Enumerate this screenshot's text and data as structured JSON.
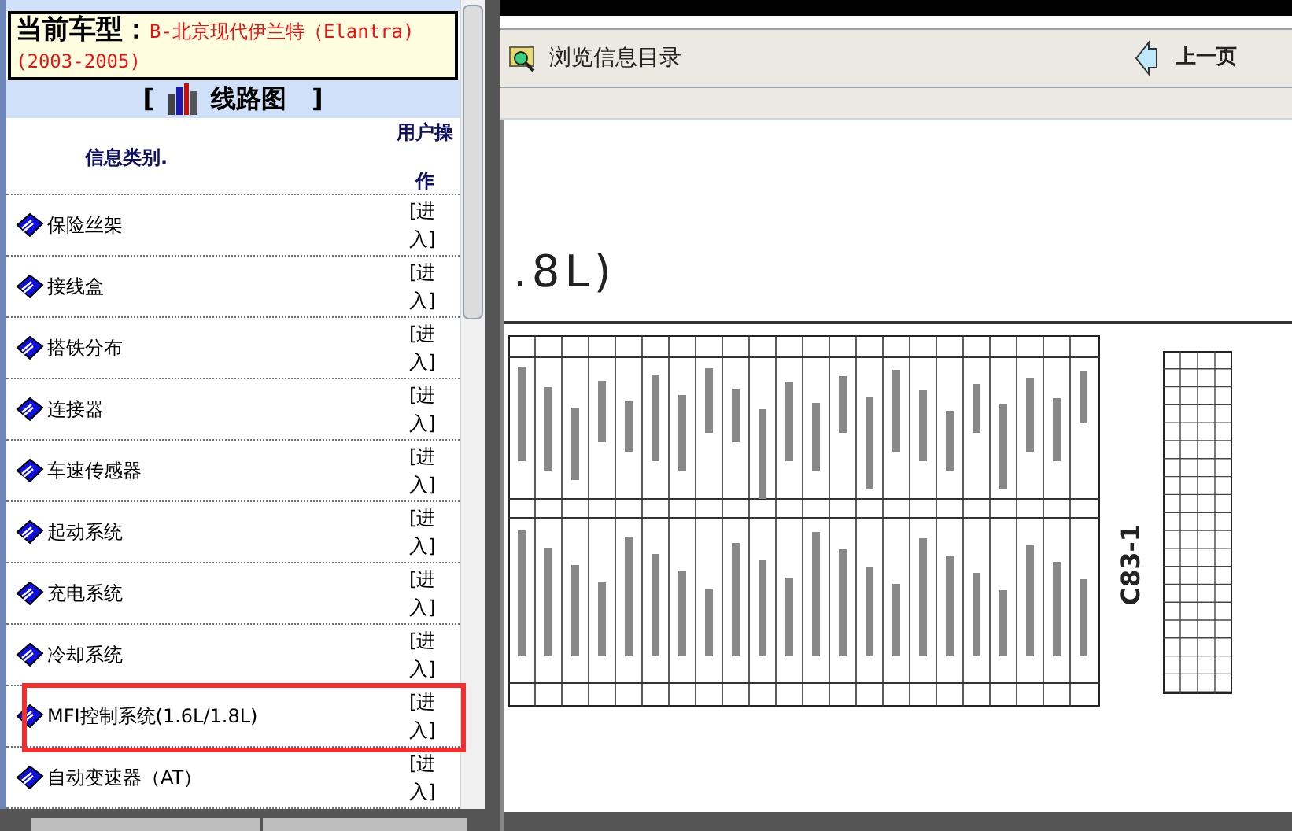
{
  "car_model": {
    "label": "当前车型：",
    "value": "B-北京现代伊兰特（Elantra)(2003-2005)"
  },
  "section_title": {
    "open": "[",
    "title": "线路图",
    "close": "]"
  },
  "table": {
    "columns": [
      "信息类别.",
      "用户操作"
    ],
    "rows": [
      {
        "name": "保险丝架",
        "action": "[进入]",
        "highlighted": false
      },
      {
        "name": "接线盒",
        "action": "[进入]",
        "highlighted": false
      },
      {
        "name": "搭铁分布",
        "action": "[进入]",
        "highlighted": false
      },
      {
        "name": "连接器",
        "action": "[进入]",
        "highlighted": false
      },
      {
        "name": "车速传感器",
        "action": "[进入]",
        "highlighted": false
      },
      {
        "name": "起动系统",
        "action": "[进入]",
        "highlighted": false
      },
      {
        "name": "充电系统",
        "action": "[进入]",
        "highlighted": false
      },
      {
        "name": "冷却系统",
        "action": "[进入]",
        "highlighted": false
      },
      {
        "name": "MFI控制系统(1.6L/1.8L)",
        "action": "[进入]",
        "highlighted": true
      },
      {
        "name": "自动变速器（AT）",
        "action": "[进入]",
        "highlighted": false
      }
    ]
  },
  "toolbar": {
    "browse": "浏览信息目录",
    "prev": "上一页"
  },
  "document": {
    "heading": ".8L)",
    "connector_label": "C83-1"
  }
}
